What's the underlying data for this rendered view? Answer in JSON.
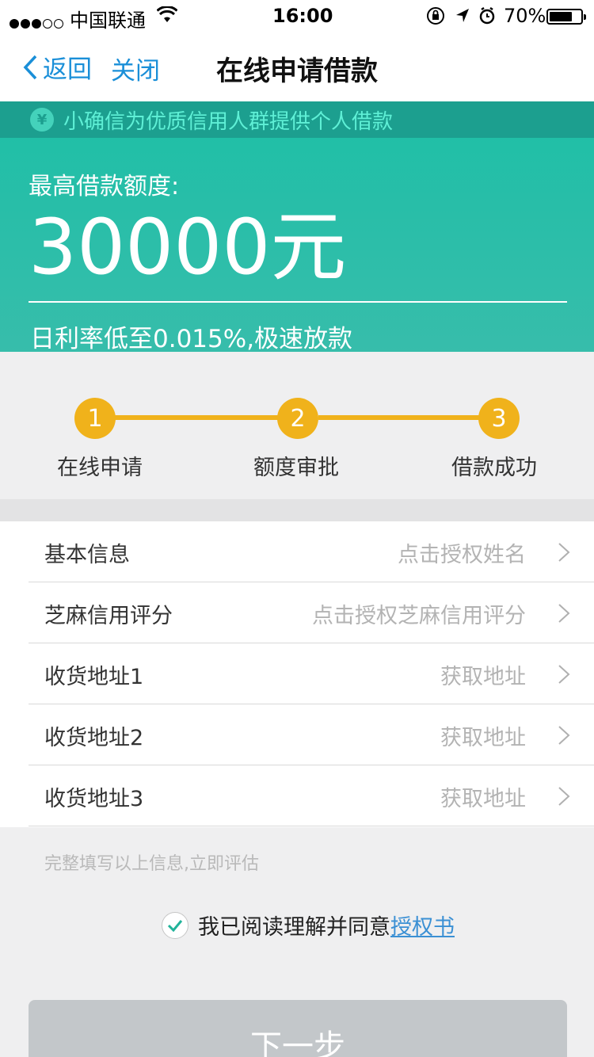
{
  "status_bar": {
    "carrier": "中国联通",
    "time": "16:00",
    "battery": "70%",
    "battery_level": 0.7
  },
  "nav": {
    "back_label": "返回",
    "close_label": "关闭",
    "title": "在线申请借款"
  },
  "banner": {
    "icon": "yen-icon",
    "text": "小确信为优质信用人群提供个人借款"
  },
  "hero": {
    "label": "最高借款额度:",
    "amount": "30000元",
    "rate": "日利率低至0.015%,极速放款"
  },
  "steps": [
    {
      "number": "1",
      "label": "在线申请"
    },
    {
      "number": "2",
      "label": "额度审批"
    },
    {
      "number": "3",
      "label": "借款成功"
    }
  ],
  "form_rows": [
    {
      "name": "基本信息",
      "hint": "点击授权姓名"
    },
    {
      "name": "芝麻信用评分",
      "hint": "点击授权芝麻信用评分"
    },
    {
      "name": "收货地址1",
      "hint": "获取地址"
    },
    {
      "name": "收货地址2",
      "hint": "获取地址"
    },
    {
      "name": "收货地址3",
      "hint": "获取地址"
    }
  ],
  "note": "完整填写以上信息,立即评估",
  "agreement": {
    "checked": true,
    "text": "我已阅读理解并同意",
    "link": "授权书"
  },
  "next_button": "下一步",
  "colors": {
    "accent": "#1a8fd8",
    "teal": "#21bfa7",
    "step_yellow": "#f0b21b",
    "disabled_button": "#c3c7ca"
  }
}
